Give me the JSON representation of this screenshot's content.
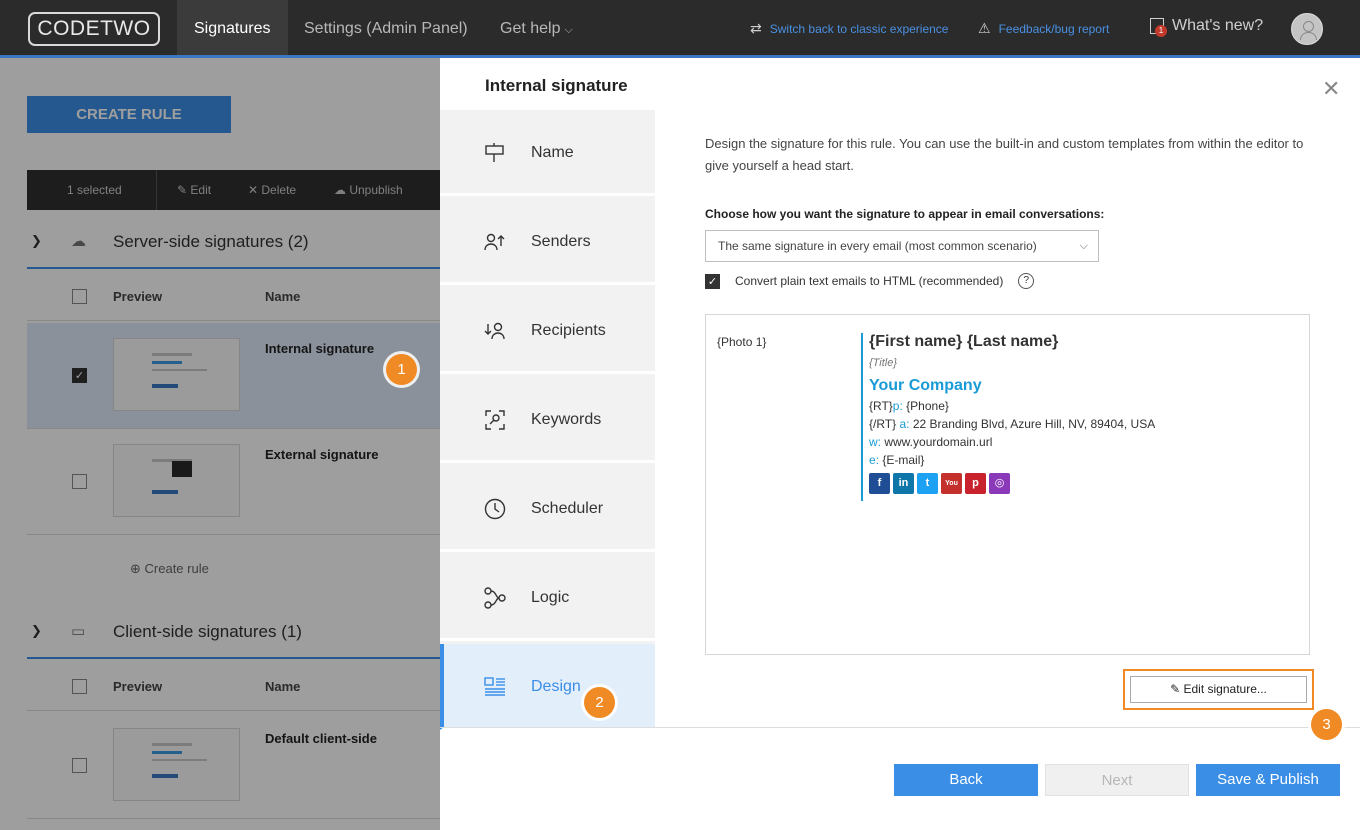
{
  "topbar": {
    "logo": "CODETWO",
    "nav": [
      "Signatures",
      "Settings (Admin Panel)",
      "Get help"
    ],
    "switch_link": "Switch back to classic experience",
    "feedback_link": "Feedback/bug report",
    "whats_new": "What's new?",
    "whats_new_badge": "1",
    "icons": {
      "switch": "swap-icon",
      "feedback": "feedback-icon",
      "news": "news-icon",
      "avatar": "user-avatar-icon"
    }
  },
  "list": {
    "create_rule": "CREATE RULE",
    "toolbar": {
      "selected": "1 selected",
      "edit": "Edit",
      "delete": "Delete",
      "unpublish": "Unpublish"
    },
    "server_section": "Server-side signatures (2)",
    "client_section": "Client-side signatures (1)",
    "col_preview": "Preview",
    "col_name": "Name",
    "rows_server": [
      {
        "name": "Internal signature",
        "selected": true
      },
      {
        "name": "External signature",
        "selected": false
      }
    ],
    "add_rule": "Create rule",
    "rows_client": [
      {
        "name": "Default client-side",
        "selected": false
      }
    ]
  },
  "dialog": {
    "title": "Internal signature",
    "close_icon": "close-icon",
    "steps": [
      {
        "label": "Name",
        "icon": "signpost-icon"
      },
      {
        "label": "Senders",
        "icon": "senders-icon"
      },
      {
        "label": "Recipients",
        "icon": "recipients-icon"
      },
      {
        "label": "Keywords",
        "icon": "keywords-icon"
      },
      {
        "label": "Scheduler",
        "icon": "clock-icon"
      },
      {
        "label": "Logic",
        "icon": "logic-icon"
      },
      {
        "label": "Design",
        "icon": "design-icon",
        "active": true
      }
    ],
    "description": "Design the signature for this rule. You can use the built-in and custom templates from within the editor to give yourself a head start.",
    "mode_label": "Choose how you want the signature to appear in email conversations:",
    "mode_value": "The same signature in every email (most common scenario)",
    "convert_label": "Convert plain text emails to HTML (recommended)",
    "convert_checked": true,
    "help_icon": "help-icon",
    "preview": {
      "photo": "{Photo 1}",
      "name": "{First name} {Last name}",
      "title": "{Title}",
      "company": "Your Company",
      "line1_prefix": "{RT}",
      "line1_key": "p:",
      "line1_val": "{Phone}",
      "line2_prefix": "{/RT}",
      "line2_key": "a:",
      "line2_val": "22 Branding Blvd, Azure Hill, NV, 89404, USA",
      "line3_key": "w:",
      "line3_val": "www.yourdomain.url",
      "line4_key": "e:",
      "line4_val": "{E-mail}",
      "socials": [
        {
          "name": "facebook-icon",
          "glyph": "f",
          "color": "#1f4e96"
        },
        {
          "name": "linkedin-icon",
          "glyph": "in",
          "color": "#0e76a8"
        },
        {
          "name": "twitter-icon",
          "glyph": "t",
          "color": "#1da1f2"
        },
        {
          "name": "youtube-icon",
          "glyph": "You",
          "color": "#c4302b"
        },
        {
          "name": "pinterest-icon",
          "glyph": "p",
          "color": "#c8232c"
        },
        {
          "name": "instagram-icon",
          "glyph": "◎",
          "color": "#8a3ab9"
        }
      ]
    },
    "edit_signature": "Edit signature...",
    "buttons": {
      "back": "Back",
      "next": "Next",
      "save": "Save & Publish"
    },
    "step_markers": [
      "1",
      "2",
      "3"
    ],
    "accent_color": "#3a8ee6",
    "marker_color": "#f08a24"
  }
}
